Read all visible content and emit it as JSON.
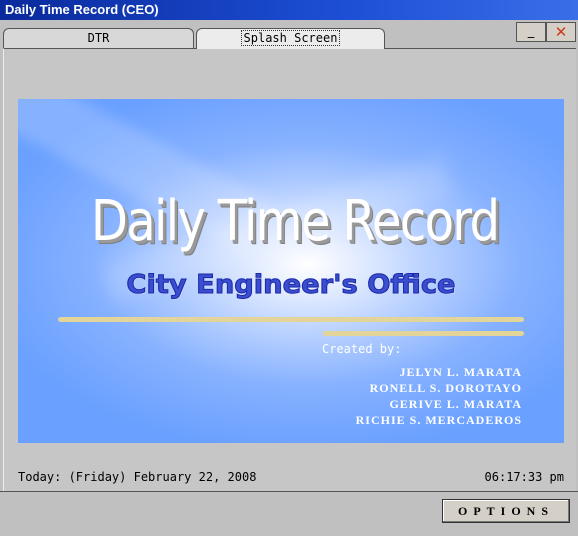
{
  "window": {
    "title": "Daily Time Record (CEO)",
    "minimize_label": "_",
    "close_label": "✕"
  },
  "tabs": [
    {
      "label": "DTR"
    },
    {
      "label": "Splash Screen",
      "selected": true
    }
  ],
  "splash": {
    "heading": "Daily Time Record",
    "subheading": "City Engineer's Office",
    "created_by_label": "Created by:",
    "creators": [
      "JELYN L. MARATA",
      "RONELL S. DOROTAYO",
      "GERIVE L. MARATA",
      "RICHIE S. MERCADEROS"
    ]
  },
  "status": {
    "date": "Today: (Friday) February 22, 2008",
    "time": "06:17:33 pm"
  },
  "options_button": "OPTIONS",
  "colors": {
    "titlebar": "#1d4fd6",
    "splash_bg": "#6aa0ff",
    "subheading": "#3b4ecf",
    "close_x": "#d03a1a"
  }
}
